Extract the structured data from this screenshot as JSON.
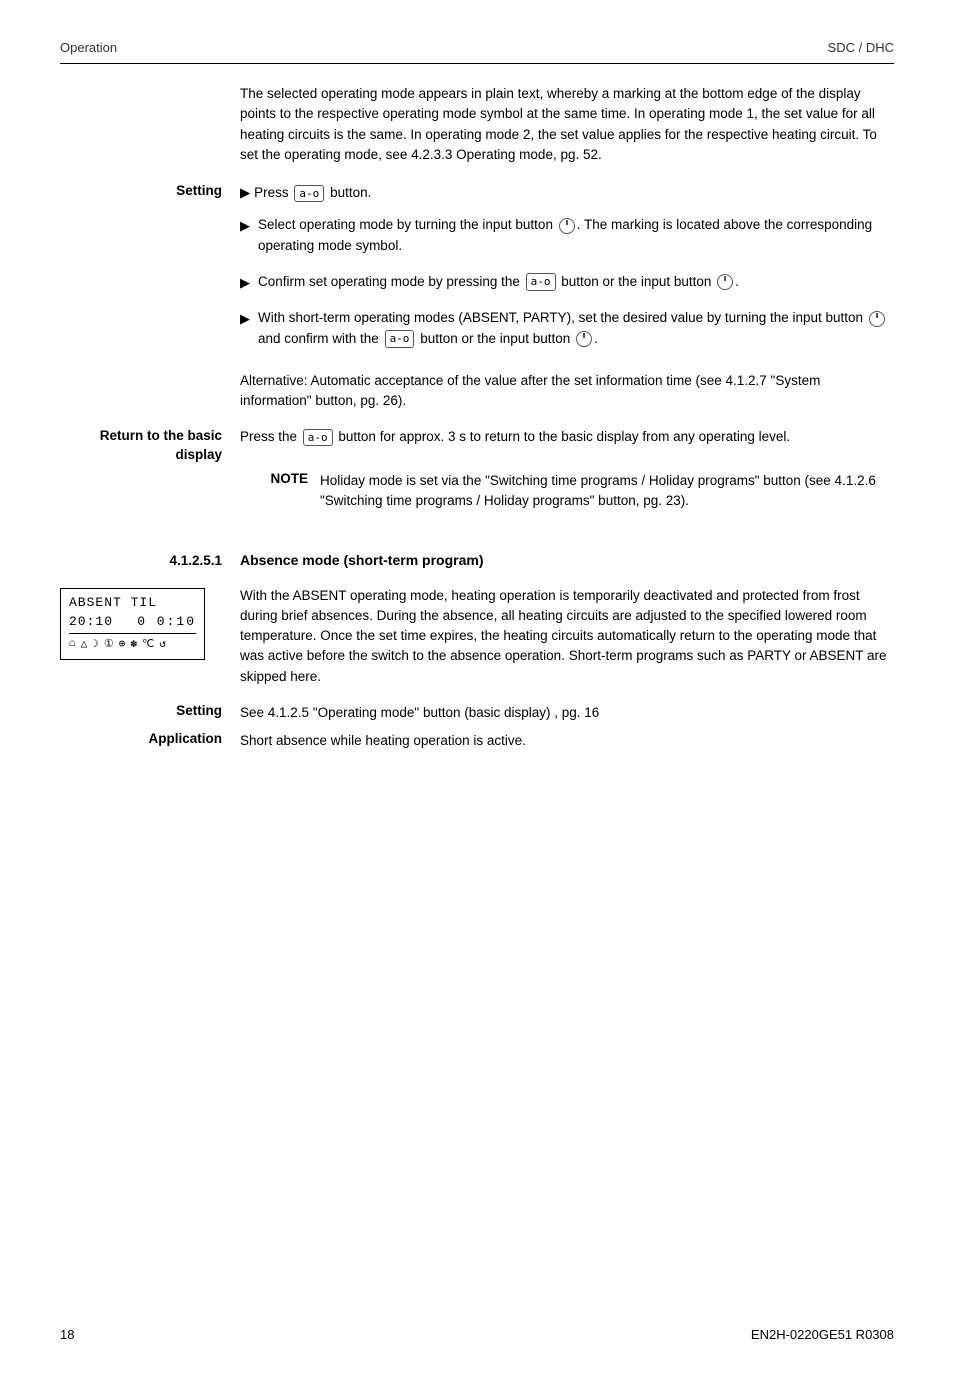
{
  "header": {
    "left": "Operation",
    "right": "SDC / DHC"
  },
  "intro": {
    "text": "The selected operating mode appears in plain text, whereby a marking at the bottom edge of the display points to the respective operating mode symbol at the same time. In operating mode 1, the set value for all heating circuits is the same. In operating mode 2, the set value applies for the respective heating circuit. To set the operating mode, see 4.2.3.3 Operating mode, pg. 52."
  },
  "setting": {
    "label": "Setting",
    "press_label": "Press",
    "btn_text": "a-o",
    "btn_label": "button.",
    "bullets": [
      {
        "text_before": "Select operating mode by turning the input button",
        "has_knob": true,
        "text_after": ". The marking is located above the corresponding operating mode symbol."
      },
      {
        "text_before": "Confirm set operating mode by pressing the",
        "has_btn": true,
        "btn_text": "a-o",
        "text_mid": "button or the input button",
        "has_knob2": true,
        "text_after": "."
      },
      {
        "text_before": "With short-term operating modes (ABSENT, PARTY), set the desired value by turning the input button",
        "has_knob": true,
        "text_mid": "and confirm with the",
        "has_btn": true,
        "btn_text": "a-o",
        "text_mid2": "button or the input button",
        "has_knob2": true,
        "text_after": "."
      }
    ]
  },
  "alternative": {
    "text": "Alternative: Automatic acceptance of the value after the set information time (see 4.1.2.7 \"System information\" button, pg. 26)."
  },
  "return_to_basic": {
    "label_line1": "Return to the basic",
    "label_line2": "display",
    "text_before": "Press the",
    "btn_text": "a-o",
    "text_after": "button for approx. 3 s to return to the basic display from any operating level."
  },
  "note": {
    "label": "NOTE",
    "text": "Holiday mode is set via the \"Switching time programs / Holiday programs\" button (see 4.1.2.6 \"Switching time programs / Holiday programs\" button, pg. 23)."
  },
  "section": {
    "number": "4.1.2.5.1",
    "title": "Absence mode (short-term program)"
  },
  "lcd_display": {
    "row1": "ABSENT TIL",
    "row2_left": "20:10",
    "row2_right": "0 0:10",
    "icons": "☆ △ ☽ ① ⊕ ✽ ℃ ↺"
  },
  "absence_text": {
    "text": "With the ABSENT operating mode, heating operation is temporarily deactivated and protected from frost during brief absences. During the absence, all heating circuits are adjusted to the specified lowered room temperature. Once the set time expires, the heating circuits automatically return to the operating mode that was active before the switch to the absence operation. Short-term programs such as PARTY or ABSENT are skipped here."
  },
  "setting2": {
    "label": "Setting",
    "text": "See 4.1.2.5 \"Operating mode\" button (basic display) , pg. 16"
  },
  "application": {
    "label": "Application",
    "text": "Short absence while heating operation is active."
  },
  "footer": {
    "left": "18",
    "right": "EN2H-0220GE51 R0308"
  }
}
